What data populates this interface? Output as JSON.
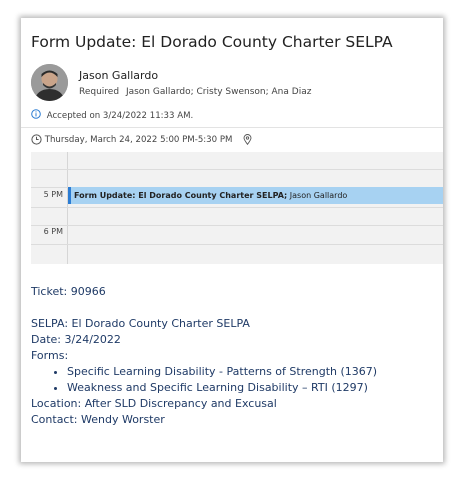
{
  "message": {
    "subject": "Form Update: El Dorado County Charter SELPA",
    "sender": "Jason Gallardo",
    "required_label": "Required",
    "required_attendees": "Jason Gallardo; Cristy Swenson; Ana Diaz",
    "accepted_text": "Accepted on 3/24/2022 11:33 AM.",
    "datetime": "Thursday, March 24, 2022 5:00 PM-5:30 PM",
    "icons": [
      "person-avatar",
      "info-icon",
      "clock-icon",
      "location-pin-icon"
    ]
  },
  "calendar": {
    "time_labels": [
      "5 PM",
      "6 PM"
    ],
    "event": {
      "title": "Form Update: El Dorado County Charter SELPA;",
      "organizer": "Jason Gallardo",
      "color": "#a7d2f2",
      "accent": "#2b7cd3"
    }
  },
  "body": {
    "ticket": "Ticket: 90966",
    "selpa": "SELPA: El Dorado County Charter SELPA",
    "date": "Date: 3/24/2022",
    "forms_label": "Forms:",
    "forms": [
      "Specific Learning Disability - Patterns of Strength (1367)",
      "Weakness and Specific Learning Disability – RTI (1297)"
    ],
    "location": "Location: After SLD Discrepancy and Excusal",
    "contact": "Contact: Wendy Worster",
    "text_color": "#1f3a66"
  }
}
